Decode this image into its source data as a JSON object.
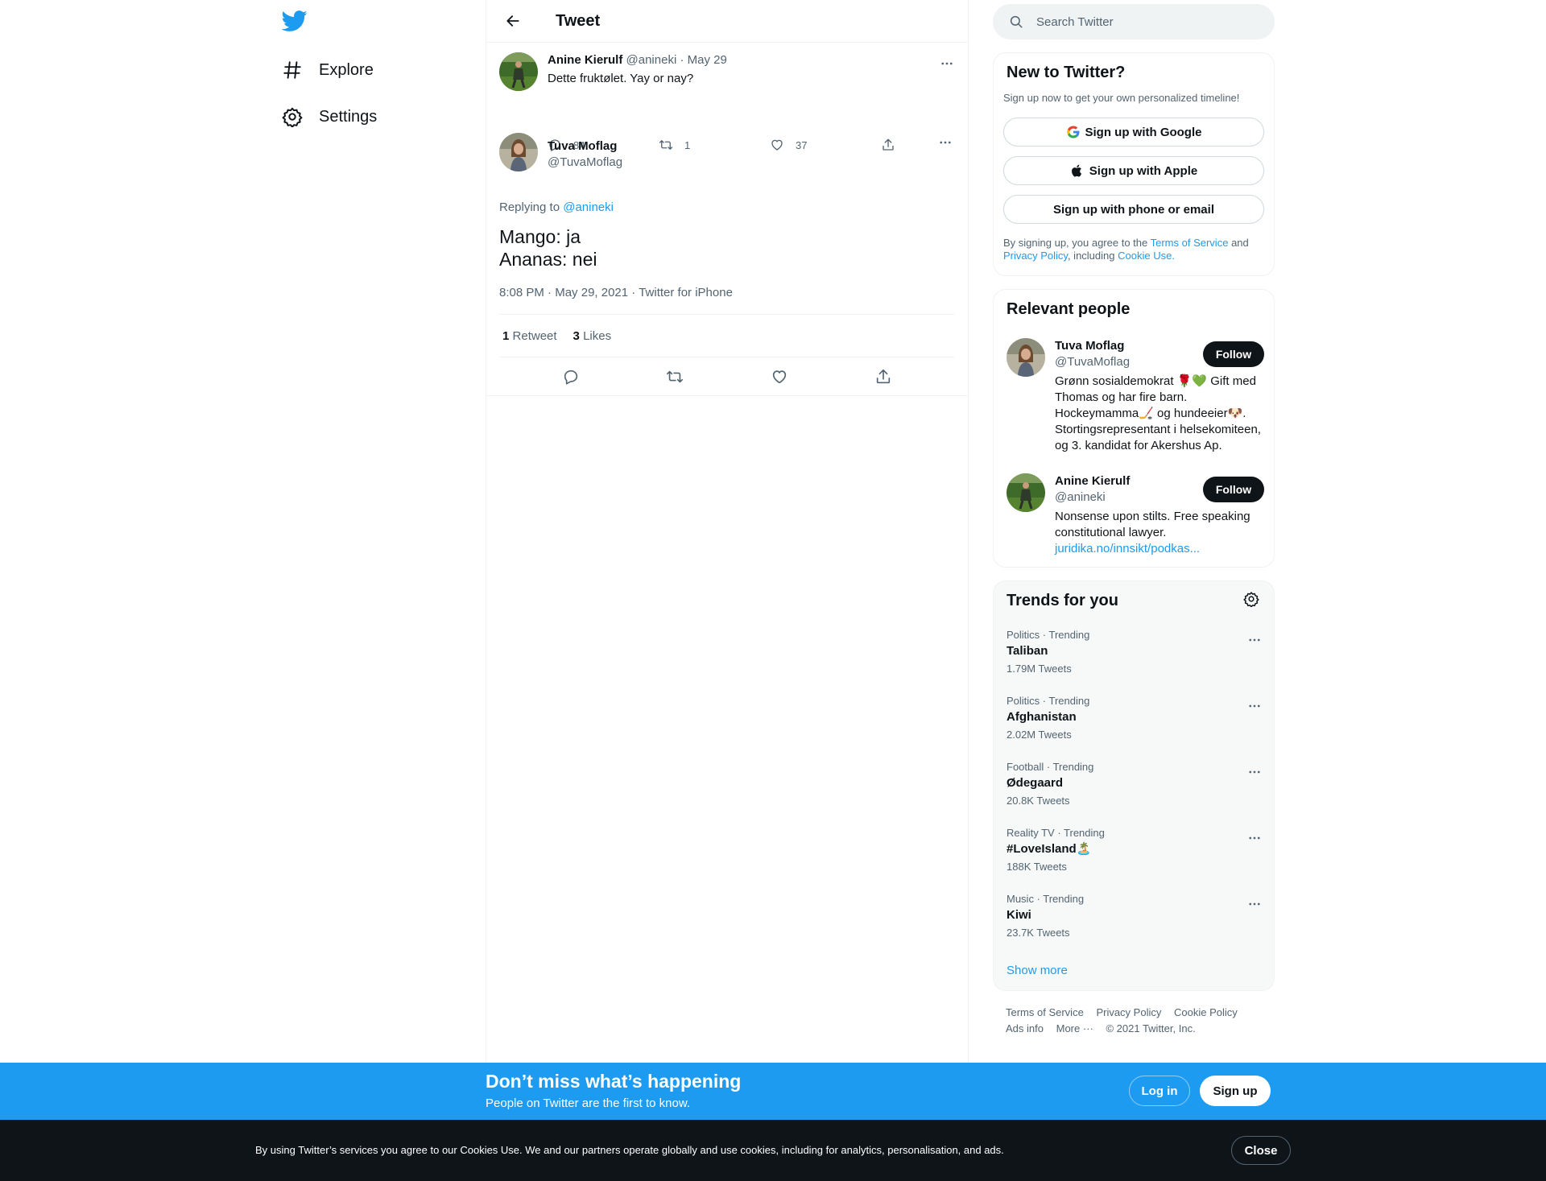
{
  "nav": {
    "logo": "twitter-bird-icon",
    "items": [
      {
        "label": "Explore",
        "icon": "hashtag-icon"
      },
      {
        "label": "Settings",
        "icon": "gear-icon"
      }
    ]
  },
  "header": {
    "title": "Tweet",
    "back_icon": "arrow-left-icon"
  },
  "parent_tweet": {
    "name": "Anine Kierulf",
    "handle": "@anineki",
    "sep": "·",
    "date": "May 29",
    "text": "Dette fruktølet. Yay or nay?",
    "replies": "84",
    "retweets": "1",
    "likes": "37"
  },
  "main_tweet": {
    "name": "Tuva Moflag",
    "handle": "@TuvaMoflag",
    "replying_label": "Replying to",
    "replying_to": "@anineki",
    "line1": "Mango: ja",
    "line2": "Ananas: nei",
    "time": "8:08 PM",
    "date": "May 29, 2021",
    "source": "Twitter for iPhone",
    "dot": "·",
    "retweet_count": "1",
    "retweet_label": "Retweet",
    "like_count": "3",
    "like_label": "Likes"
  },
  "search": {
    "placeholder": "Search Twitter"
  },
  "signup": {
    "title": "New to Twitter?",
    "subtitle": "Sign up now to get your own personalized timeline!",
    "google": "Sign up with Google",
    "apple": "Sign up with Apple",
    "phone": "Sign up with phone or email",
    "terms_pre": "By signing up, you agree to the",
    "terms_link": "Terms of Service",
    "terms_and": "and",
    "privacy_link": "Privacy Policy",
    "terms_including": ", including",
    "cookie_link": "Cookie Use."
  },
  "people": {
    "title": "Relevant people",
    "list": [
      {
        "name": "Tuva Moflag",
        "handle": "@TuvaMoflag",
        "follow": "Follow",
        "bio": "Grønn sosialdemokrat 🌹💚 Gift med Thomas og har fire barn. Hockeymamma🏒 og hundeeier🐶. Stortingsrepresentant i helsekomiteen, og 3. kandidat for Akershus Ap."
      },
      {
        "name": "Anine Kierulf",
        "handle": "@anineki",
        "follow": "Follow",
        "bio": "Nonsense upon stilts. Free speaking constitutional lawyer.",
        "link": "juridika.no/innsikt/podkas..."
      }
    ]
  },
  "trends": {
    "title": "Trends for you",
    "items": [
      {
        "context": "Politics · Trending",
        "name": "Taliban",
        "count": "1.79M Tweets"
      },
      {
        "context": "Politics · Trending",
        "name": "Afghanistan",
        "count": "2.02M Tweets"
      },
      {
        "context": "Football · Trending",
        "name": "Ødegaard",
        "count": "20.8K Tweets"
      },
      {
        "context": "Reality TV · Trending",
        "name": "#LoveIsland🏝️",
        "count": "188K Tweets"
      },
      {
        "context": "Music · Trending",
        "name": "Kiwi",
        "count": "23.7K Tweets"
      }
    ],
    "show_more": "Show more"
  },
  "footer": {
    "terms": "Terms of Service",
    "privacy": "Privacy Policy",
    "cookie": "Cookie Policy",
    "ads": "Ads info",
    "more": "More ···",
    "copyright": "© 2021 Twitter, Inc."
  },
  "banner": {
    "title": "Don’t miss what’s happening",
    "subtitle": "People on Twitter are the first to know.",
    "login": "Log in",
    "signup": "Sign up"
  },
  "cookies": {
    "text": "By using Twitter’s services you agree to our Cookies Use. We and our partners operate globally and use cookies, including for analytics, personalisation, and ads.",
    "close": "Close"
  },
  "colors": {
    "accent": "#1d9bf0",
    "text": "#0f1419",
    "secondary": "#536471",
    "banner": "#1d9bf0",
    "cookie_bar": "#0f1419"
  }
}
